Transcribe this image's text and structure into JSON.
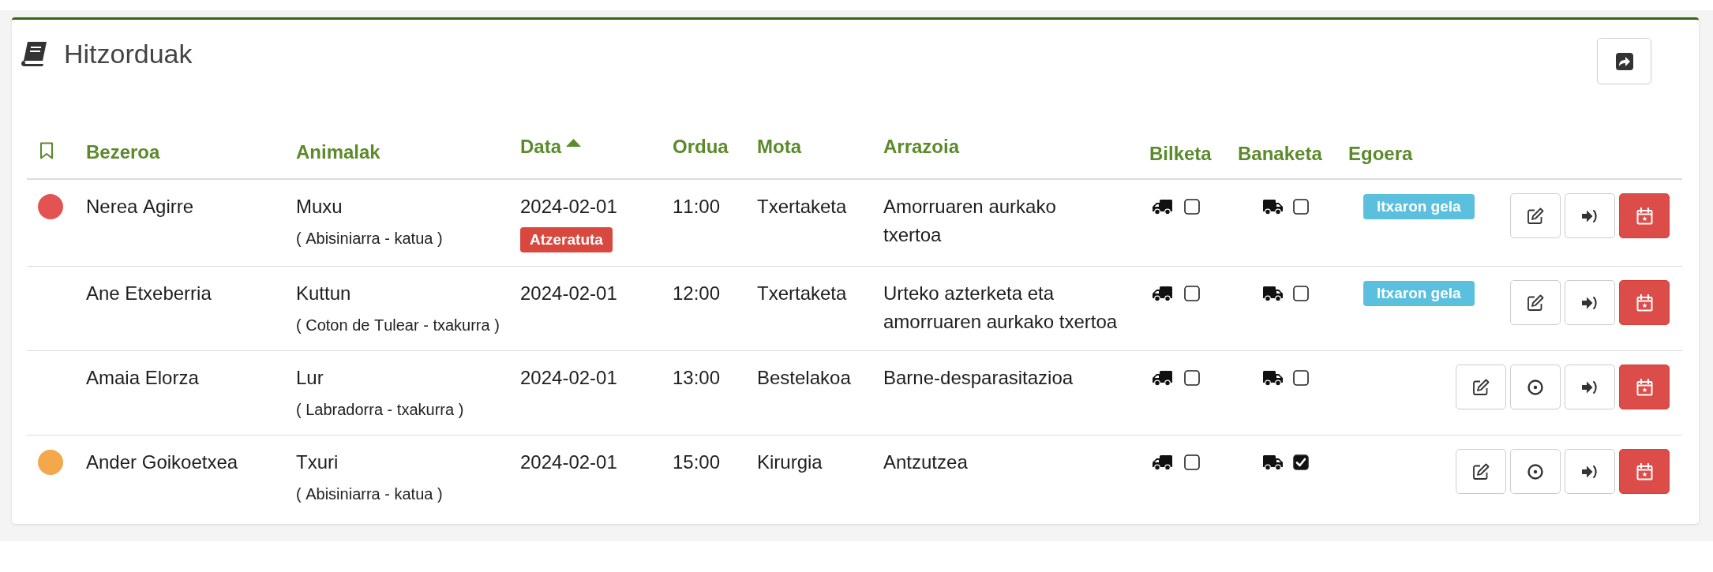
{
  "title": "Hitzorduak",
  "table": {
    "columns": [
      {
        "label": "Bezeroa",
        "sorted": false
      },
      {
        "label": "Animalak",
        "sorted": false
      },
      {
        "label": "Data",
        "sorted": true
      },
      {
        "label": "Ordua",
        "sorted": false
      },
      {
        "label": "Mota",
        "sorted": false
      },
      {
        "label": "Arrazoia",
        "sorted": false
      },
      {
        "label": "Bilketa",
        "sorted": false
      },
      {
        "label": "Banaketa",
        "sorted": false
      },
      {
        "label": "Egoera",
        "sorted": false
      }
    ],
    "rows": [
      {
        "color": "#e25352",
        "client": "Nerea Agirre",
        "animal": "Muxu",
        "breed": "( Abisiniarra - katua )",
        "date": "2024-02-01",
        "date_badge": "Atzeratuta",
        "time": "11:00",
        "type": "Txertaketa",
        "reason": "Amorruaren aurkako txertoa",
        "pickup": false,
        "delivery": false,
        "status": "Itxaron gela",
        "actions": [
          {
            "kind": "edit"
          },
          {
            "kind": "enter"
          },
          {
            "kind": "calendar"
          }
        ]
      },
      {
        "client": "Ane Etxeberria",
        "animal": "Kuttun",
        "breed": "( Coton de Tulear - txakurra )",
        "date": "2024-02-01",
        "time": "12:00",
        "type": "Txertaketa",
        "reason": "Urteko azterketa eta amorruaren aurkako txertoa",
        "pickup": false,
        "delivery": false,
        "status": "Itxaron gela",
        "actions": [
          {
            "kind": "edit"
          },
          {
            "kind": "enter"
          },
          {
            "kind": "calendar"
          }
        ]
      },
      {
        "client": "Amaia Elorza",
        "animal": "Lur",
        "breed": "( Labradorra - txakurra )",
        "date": "2024-02-01",
        "time": "13:00",
        "type": "Bestelakoa",
        "reason": "Barne-desparasitazioa",
        "pickup": false,
        "delivery": false,
        "actions": [
          {
            "kind": "edit"
          },
          {
            "kind": "target"
          },
          {
            "kind": "enter"
          },
          {
            "kind": "calendar"
          }
        ]
      },
      {
        "color": "#f4a74b",
        "client": "Ander Goikoetxea",
        "animal": "Txuri",
        "breed": "( Abisiniarra - katua )",
        "date": "2024-02-01",
        "time": "15:00",
        "type": "Kirurgia",
        "reason": "Antzutzea",
        "pickup": false,
        "delivery": true,
        "actions": [
          {
            "kind": "edit"
          },
          {
            "kind": "target"
          },
          {
            "kind": "enter"
          },
          {
            "kind": "calendar"
          }
        ]
      }
    ]
  }
}
